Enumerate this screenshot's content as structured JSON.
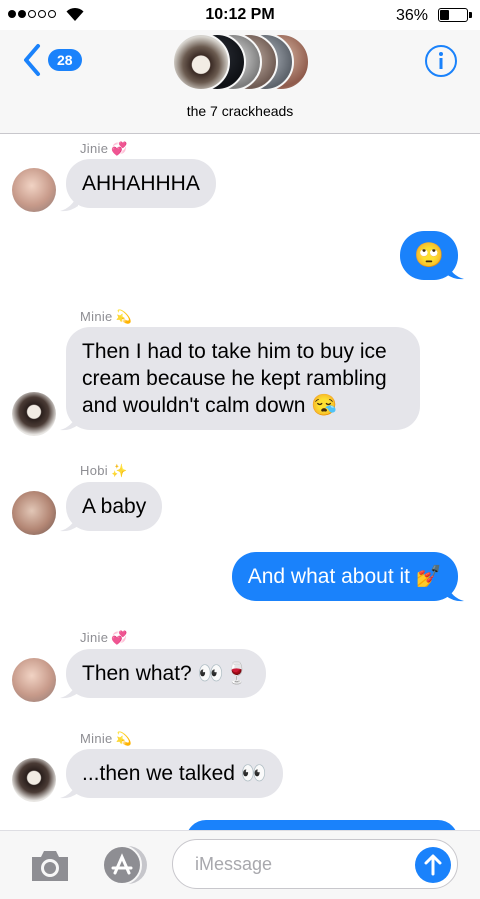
{
  "status_bar": {
    "time": "10:12 PM",
    "battery_percent": "36%",
    "battery_level": 0.36
  },
  "header": {
    "back_count": "28",
    "group_name": "the 7 crackheads"
  },
  "messages": [
    {
      "sender": "Jinie",
      "sender_emoji": "💞",
      "text": "AHHAHHHA",
      "direction": "incoming"
    },
    {
      "text": "🙄",
      "direction": "outgoing"
    },
    {
      "sender": "Minie",
      "sender_emoji": "💫",
      "lines": [
        "Then I had to take him to buy ice",
        "cream because he kept rambling",
        "and wouldn't calm down 😪"
      ],
      "direction": "incoming"
    },
    {
      "sender": "Hobi",
      "sender_emoji": "✨",
      "text": "A baby",
      "direction": "incoming"
    },
    {
      "text": "And what about it 💅",
      "direction": "outgoing"
    },
    {
      "sender": "Jinie",
      "sender_emoji": "💞",
      "text": "Then what? 👀🍷",
      "direction": "incoming"
    },
    {
      "sender": "Minie",
      "sender_emoji": "💫",
      "text": "...then we talked 👀",
      "direction": "incoming"
    }
  ],
  "input": {
    "placeholder": "iMessage"
  },
  "colors": {
    "accent": "#1a82fb",
    "incoming_bubble": "#e5e5ea",
    "header_bg": "#f7f7f7"
  },
  "icons": [
    "back-chevron-icon",
    "info-icon",
    "camera-icon",
    "app-store-icon",
    "send-arrow-icon",
    "wifi-icon"
  ]
}
